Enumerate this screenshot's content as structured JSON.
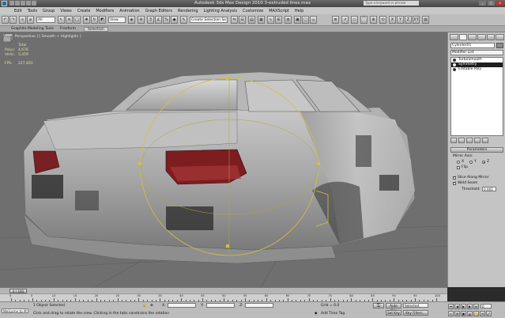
{
  "titlebar": {
    "title": "Autodesk 3ds Max Design 2010     3-extruded lines.max",
    "search_placeholder": "Type a keyword or phrase",
    "min": "_",
    "max": "□",
    "close": "×"
  },
  "menubar": {
    "items": [
      "Edit",
      "Tools",
      "Group",
      "Views",
      "Create",
      "Modifiers",
      "Animation",
      "Graph Editors",
      "Rendering",
      "Lighting Analysis",
      "Customize",
      "MAXScript",
      "Help"
    ]
  },
  "toolbar": {
    "filter": "All",
    "refcoord": "View",
    "selset": "Create Selection Se",
    "icons": [
      "undo-icon",
      "redo-icon",
      "link-icon",
      "unlink-icon",
      "select-icon",
      "select-by-name-icon",
      "rect-select-icon",
      "move-icon",
      "rotate-icon",
      "scale-icon",
      "snap-icon",
      "angle-snap-icon",
      "mirror-icon",
      "align-icon",
      "layer-icon",
      "curve-editor-icon",
      "schematic-icon",
      "material-editor-icon",
      "render-setup-icon",
      "render-icon"
    ]
  },
  "ribbon": {
    "tabs": [
      "Graphite Modeling Tools",
      "Freeform",
      "Selection"
    ]
  },
  "viewport": {
    "label": "[ + ] [ Perspective ] [ Smooth + Highlights ]",
    "stats": {
      "header": "Total",
      "rows": [
        {
          "k": "Polys:",
          "v": "4,676"
        },
        {
          "k": "Verts:",
          "v": "5,459"
        }
      ],
      "fps_label": "FPS:",
      "fps_value": "227.403"
    }
  },
  "command_panel": {
    "object_name": "Cylinder01",
    "modifier_list": "Modifier List",
    "stack": [
      {
        "label": "TurboSmooth",
        "selected": false
      },
      {
        "label": "Symmetry",
        "selected": true
      },
      {
        "label": "Editable Poly",
        "selected": false
      }
    ],
    "rollout_title": "Parameters",
    "mirror_axis_label": "Mirror Axis:",
    "axes": [
      "X",
      "Y",
      "Z"
    ],
    "axis_selected": "Z",
    "flip_label": "Flip",
    "slice_label": "Slice Along Mirror",
    "weld_label": "Weld Seam",
    "threshold_label": "Threshold:",
    "threshold_value": "0.001"
  },
  "timeline": {
    "frame": "0 / 100",
    "ticks": [
      "0",
      "5",
      "10",
      "15",
      "20",
      "25",
      "30",
      "35",
      "40",
      "45",
      "50",
      "55",
      "60",
      "65",
      "70",
      "75",
      "80",
      "85",
      "90",
      "95",
      "100"
    ]
  },
  "statusbar": {
    "welcome": "Welcome to M",
    "selected": "1 Object Selected",
    "prompt": "Click and drag to rotate the view.  Clicking in the tabs constrains the rotation",
    "x_label": "X:",
    "y_label": "Y:",
    "z_label": "Z:",
    "grid": "Grid = 0.0",
    "auto_key": "Auto Key",
    "set_key": "Set Key",
    "selected_drop": "Selected",
    "key_filters": "Key Filters...",
    "add_time_tag": "Add Time Tag",
    "frame_field": "0"
  }
}
